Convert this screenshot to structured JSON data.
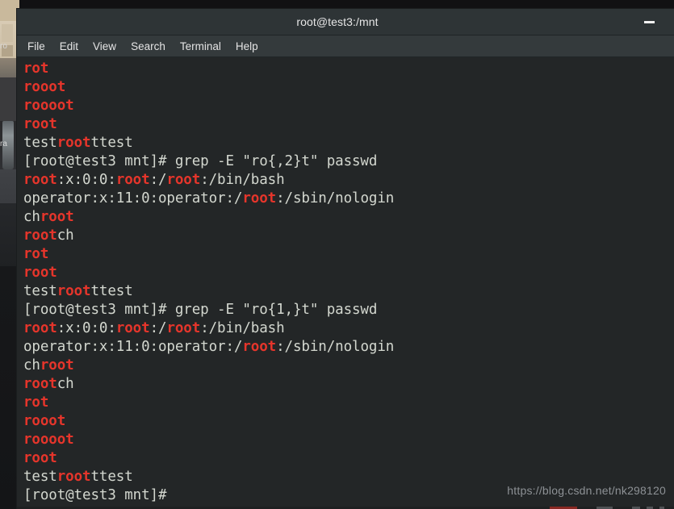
{
  "window": {
    "title": "root@test3:/mnt",
    "minimize_label": "Minimize"
  },
  "menubar": {
    "items": [
      {
        "label": "File"
      },
      {
        "label": "Edit"
      },
      {
        "label": "View"
      },
      {
        "label": "Search"
      },
      {
        "label": "Terminal"
      },
      {
        "label": "Help"
      }
    ]
  },
  "desktop": {
    "left_labels": [
      "ro",
      "ra"
    ]
  },
  "watermark": {
    "text": "https://blog.csdn.net/nk298120"
  },
  "terminal": {
    "prompt": "[root@test3 mnt]# ",
    "match_color": "#e5352b",
    "text_color": "#d3d7cf",
    "background": "#232627",
    "lines": [
      {
        "segments": [
          {
            "t": "rot",
            "m": true
          }
        ]
      },
      {
        "segments": [
          {
            "t": "rooot",
            "m": true
          }
        ]
      },
      {
        "segments": [
          {
            "t": "roooot",
            "m": true
          }
        ]
      },
      {
        "segments": [
          {
            "t": "root",
            "m": true
          }
        ]
      },
      {
        "segments": [
          {
            "t": "test",
            "m": false
          },
          {
            "t": "root",
            "m": true
          },
          {
            "t": "ttest",
            "m": false
          }
        ]
      },
      {
        "segments": [
          {
            "t": "[root@test3 mnt]# grep -E \"ro{,2}t\" passwd",
            "m": false
          }
        ]
      },
      {
        "segments": [
          {
            "t": "root",
            "m": true
          },
          {
            "t": ":x:0:0:",
            "m": false
          },
          {
            "t": "root",
            "m": true
          },
          {
            "t": ":/",
            "m": false
          },
          {
            "t": "root",
            "m": true
          },
          {
            "t": ":/bin/bash",
            "m": false
          }
        ]
      },
      {
        "segments": [
          {
            "t": "operator:x:11:0:operator:/",
            "m": false
          },
          {
            "t": "root",
            "m": true
          },
          {
            "t": ":/sbin/nologin",
            "m": false
          }
        ]
      },
      {
        "segments": [
          {
            "t": "ch",
            "m": false
          },
          {
            "t": "root",
            "m": true
          }
        ]
      },
      {
        "segments": [
          {
            "t": "root",
            "m": true
          },
          {
            "t": "ch",
            "m": false
          }
        ]
      },
      {
        "segments": [
          {
            "t": "rot",
            "m": true
          }
        ]
      },
      {
        "segments": [
          {
            "t": "root",
            "m": true
          }
        ]
      },
      {
        "segments": [
          {
            "t": "test",
            "m": false
          },
          {
            "t": "root",
            "m": true
          },
          {
            "t": "ttest",
            "m": false
          }
        ]
      },
      {
        "segments": [
          {
            "t": "[root@test3 mnt]# grep -E \"ro{1,}t\" passwd",
            "m": false
          }
        ]
      },
      {
        "segments": [
          {
            "t": "root",
            "m": true
          },
          {
            "t": ":x:0:0:",
            "m": false
          },
          {
            "t": "root",
            "m": true
          },
          {
            "t": ":/",
            "m": false
          },
          {
            "t": "root",
            "m": true
          },
          {
            "t": ":/bin/bash",
            "m": false
          }
        ]
      },
      {
        "segments": [
          {
            "t": "operator:x:11:0:operator:/",
            "m": false
          },
          {
            "t": "root",
            "m": true
          },
          {
            "t": ":/sbin/nologin",
            "m": false
          }
        ]
      },
      {
        "segments": [
          {
            "t": "ch",
            "m": false
          },
          {
            "t": "root",
            "m": true
          }
        ]
      },
      {
        "segments": [
          {
            "t": "root",
            "m": true
          },
          {
            "t": "ch",
            "m": false
          }
        ]
      },
      {
        "segments": [
          {
            "t": "rot",
            "m": true
          }
        ]
      },
      {
        "segments": [
          {
            "t": "rooot",
            "m": true
          }
        ]
      },
      {
        "segments": [
          {
            "t": "roooot",
            "m": true
          }
        ]
      },
      {
        "segments": [
          {
            "t": "root",
            "m": true
          }
        ]
      },
      {
        "segments": [
          {
            "t": "test",
            "m": false
          },
          {
            "t": "root",
            "m": true
          },
          {
            "t": "ttest",
            "m": false
          }
        ]
      },
      {
        "segments": [
          {
            "t": "[root@test3 mnt]#",
            "m": false
          }
        ]
      }
    ]
  }
}
